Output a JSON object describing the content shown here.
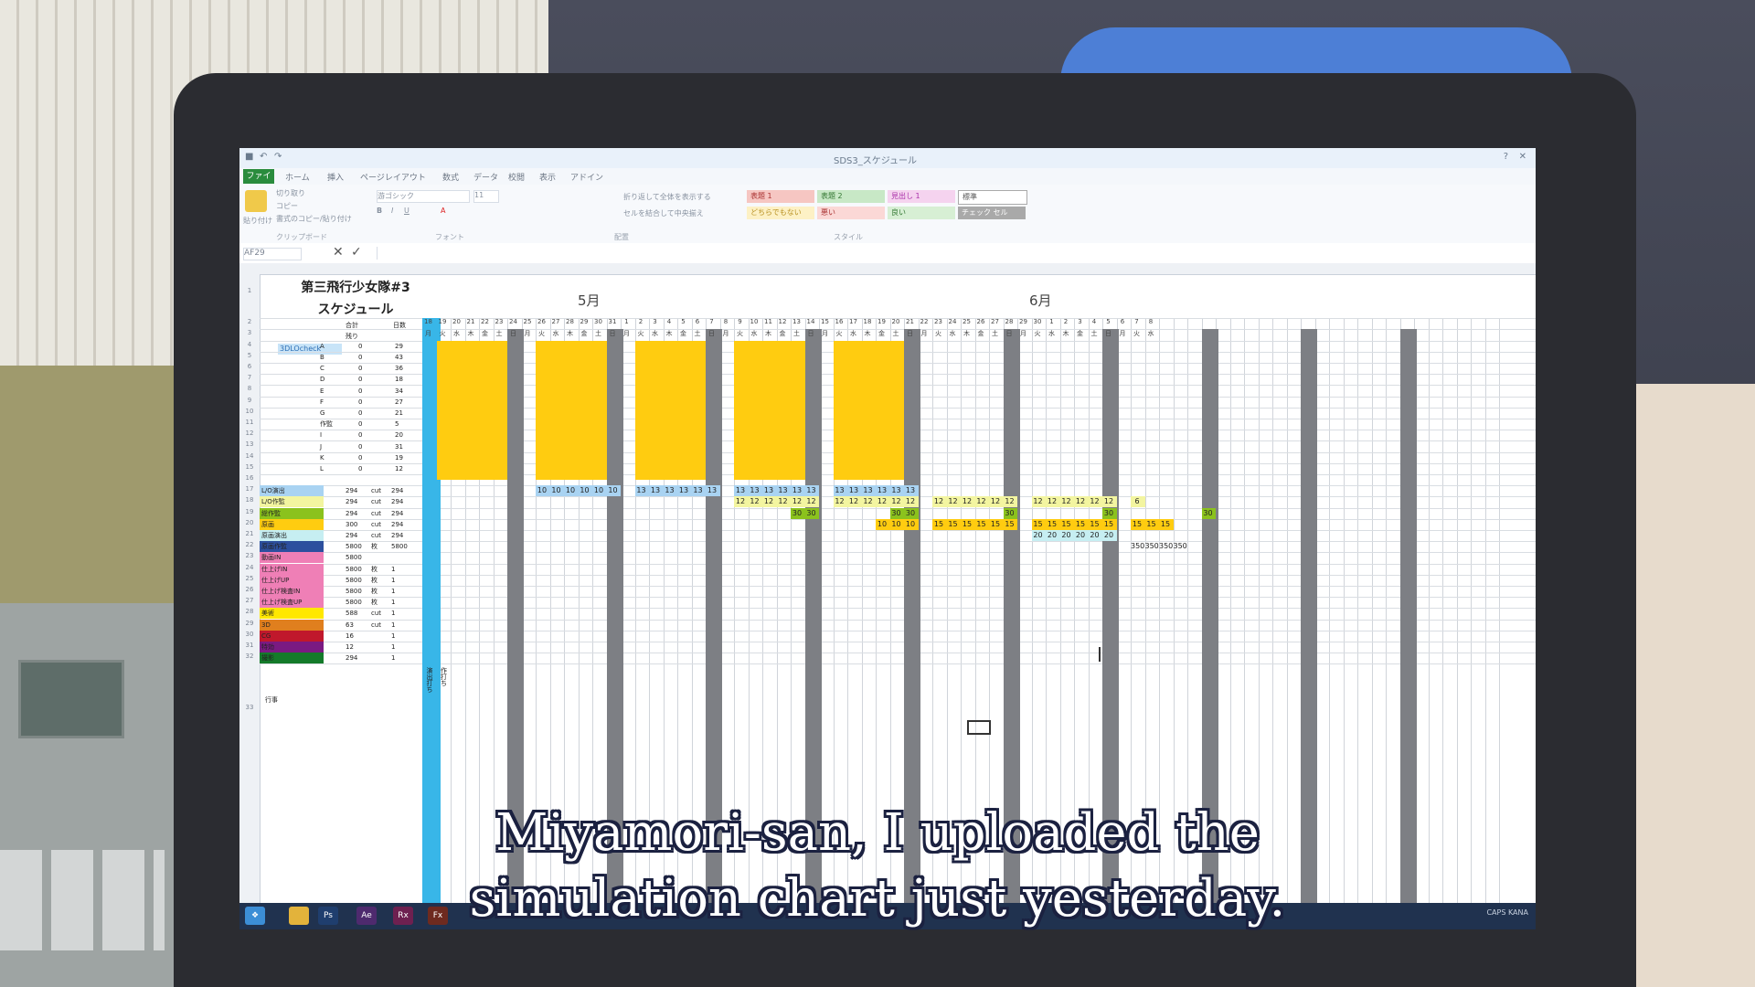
{
  "excel": {
    "title": "SDS3_スケジュール",
    "tabs": [
      "ファイル",
      "ホーム",
      "挿入",
      "ページレイアウト",
      "数式",
      "データ",
      "校閲",
      "表示",
      "アドイン"
    ],
    "clipboard": {
      "paste": "貼り付け",
      "cut": "切り取り",
      "copy": "コピー",
      "format": "書式のコピー/貼り付け",
      "group": "クリップボード"
    },
    "font": {
      "name": "游ゴシック",
      "size": "11",
      "group": "フォント"
    },
    "alignment": {
      "wrap": "折り返して全体を表示する",
      "merge": "セルを結合して中央揃え",
      "group": "配置"
    },
    "styles": {
      "items": [
        "表題 1",
        "表題 2",
        "見出し 1",
        "標準",
        "どちらでもない",
        "悪い",
        "良い",
        "チェック セル"
      ],
      "group": "スタイル"
    },
    "name_box": "AF29"
  },
  "sheet": {
    "title_line1": "第三飛行少女隊#3",
    "title_line2": "スケジュール",
    "header_total": "合計",
    "header_remaining": "残り",
    "header_count": "日数",
    "check_label": "3DLOcheck",
    "months": [
      "5月",
      "6月"
    ],
    "letters": [
      "A",
      "B",
      "C",
      "D",
      "E",
      "F",
      "G",
      "作監",
      "I",
      "J",
      "K",
      "L"
    ],
    "letter_vals": [
      "0",
      "0",
      "0",
      "0",
      "0",
      "0",
      "0",
      "0",
      "0",
      "0",
      "0",
      "0"
    ],
    "letter_days": [
      "29",
      "43",
      "36",
      "18",
      "34",
      "27",
      "21",
      "5",
      "20",
      "31",
      "19",
      "12"
    ],
    "rows": [
      {
        "label": "L/O演出",
        "total": "294",
        "unit": "cut",
        "rem": "294"
      },
      {
        "label": "L/O作監",
        "total": "294",
        "unit": "cut",
        "rem": "294"
      },
      {
        "label": "総作監",
        "total": "294",
        "unit": "cut",
        "rem": "294"
      },
      {
        "label": "原画",
        "total": "300",
        "unit": "cut",
        "rem": "294"
      },
      {
        "label": "原画演出",
        "total": "294",
        "unit": "cut",
        "rem": "294"
      },
      {
        "label": "原画作監",
        "total": "5800",
        "unit": "枚",
        "rem": "5800"
      },
      {
        "label": "動画IN",
        "total": "5800",
        "unit": "",
        "rem": ""
      },
      {
        "label": "仕上げIN",
        "total": "5800",
        "unit": "枚",
        "rem": "1"
      },
      {
        "label": "仕上げUP",
        "total": "5800",
        "unit": "枚",
        "rem": "1"
      },
      {
        "label": "仕上げ検査IN",
        "total": "5800",
        "unit": "枚",
        "rem": "1"
      },
      {
        "label": "仕上げ検査UP",
        "total": "5800",
        "unit": "枚",
        "rem": "1"
      },
      {
        "label": "美術",
        "total": "588",
        "unit": "cut",
        "rem": "1"
      },
      {
        "label": "3D",
        "total": "63",
        "unit": "cut",
        "rem": "1"
      },
      {
        "label": "CG",
        "total": "16",
        "unit": "",
        "rem": "1"
      },
      {
        "label": "特効",
        "total": "12",
        "unit": "",
        "rem": "1"
      },
      {
        "label": "撮影",
        "total": "294",
        "unit": "",
        "rem": "1"
      }
    ],
    "row33_label": "行事",
    "row33_vertical": "演出打ち",
    "row33_vertical2": "作打ち",
    "days_may": [
      "18",
      "19",
      "20",
      "21",
      "22",
      "23",
      "24",
      "25",
      "26",
      "27",
      "28",
      "29",
      "30",
      "31"
    ],
    "weekdays_may": [
      "月",
      "火",
      "水",
      "木",
      "金",
      "土",
      "日",
      "月",
      "火",
      "水",
      "木",
      "金",
      "土",
      "日"
    ],
    "days_june": [
      "1",
      "2",
      "3",
      "4",
      "5",
      "6",
      "7",
      "8",
      "9",
      "10",
      "11",
      "12",
      "13",
      "14",
      "15",
      "16",
      "17",
      "18",
      "19",
      "20",
      "21",
      "22",
      "23",
      "24",
      "25",
      "26",
      "27",
      "28",
      "29",
      "30"
    ],
    "days_july": [
      "1",
      "2",
      "3",
      "4",
      "5",
      "6",
      "7",
      "8"
    ],
    "val_10": "10",
    "val_12": "12",
    "val_13": "13",
    "val_15": "15",
    "val_20": "20",
    "val_30": "30",
    "val_6": "6",
    "val_350": "350"
  },
  "taskbar": {
    "apps": [
      "Ps",
      "Ae",
      "Rx",
      "Fx"
    ],
    "tray_caps": "CAPS",
    "tray_kana": "KANA"
  },
  "subtitle": {
    "line1": "Miyamori-san, I uploaded the",
    "line2": "simulation chart just yesterday."
  },
  "colors": {
    "yellow": "#ffcc10",
    "today": "#38b6e8",
    "weekend": "#7d7f84",
    "green": "#8bc21d",
    "light_blue": "#a9d3f2",
    "light_yellow": "#f3f5a0",
    "cyan_row": "#c6eef2"
  }
}
